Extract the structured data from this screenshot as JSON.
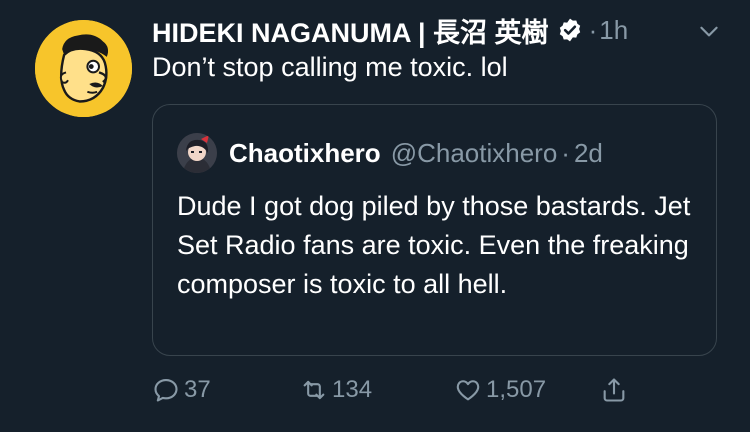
{
  "tweet": {
    "author_name": "HIDEKI NAGANUMA | 長沼 英樹",
    "separator": "·",
    "time": "1h",
    "text": "Don’t stop calling me toxic. lol"
  },
  "quote": {
    "author_name": "Chaotixhero",
    "handle": "@Chaotixhero",
    "separator": "·",
    "time": "2d",
    "text": "Dude I got dog piled by those bastards. Jet Set Radio fans are toxic. Even the freaking composer is toxic to all hell."
  },
  "actions": {
    "reply_count": "37",
    "retweet_count": "134",
    "like_count": "1,507"
  },
  "icons": {
    "verified": "verified-badge-icon",
    "more": "chevron-down-icon",
    "reply": "reply-icon",
    "retweet": "retweet-icon",
    "like": "heart-icon",
    "share": "share-icon"
  },
  "colors": {
    "background": "#15202b",
    "secondary_text": "#8899a6",
    "border": "#38444d",
    "avatar_yellow": "#f7c52b"
  }
}
